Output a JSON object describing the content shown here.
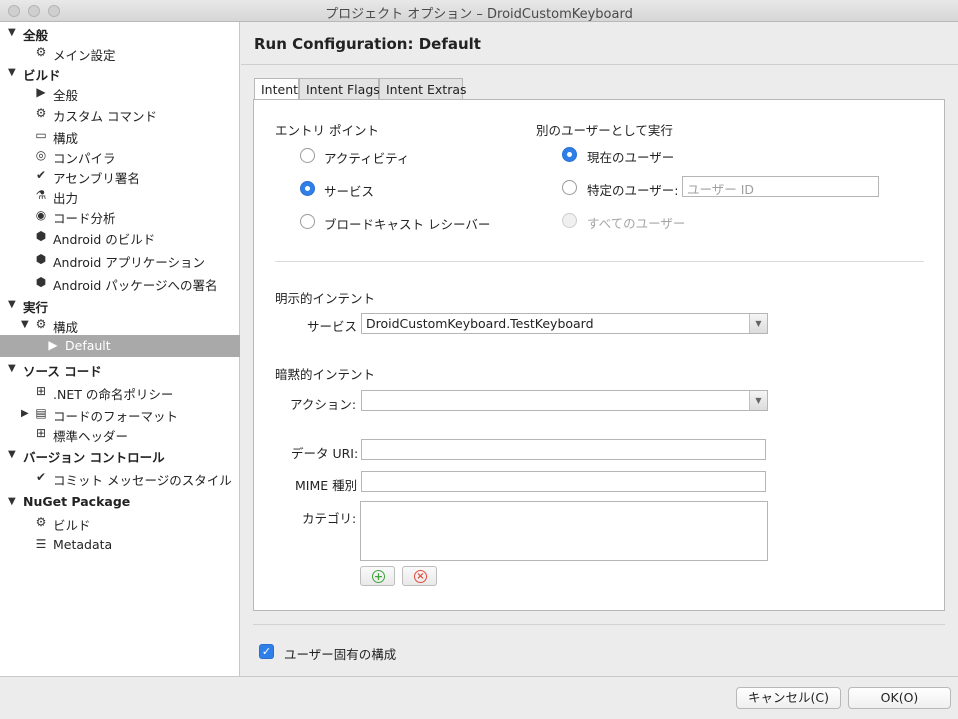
{
  "window": {
    "title": "プロジェクト オプション – DroidCustomKeyboard"
  },
  "sidebar": {
    "items": [
      {
        "label": "全般",
        "arrow": "▼",
        "icon": ""
      },
      {
        "label": "メイン設定",
        "arrow": "",
        "icon": "⚙"
      },
      {
        "label": "ビルド",
        "arrow": "▼",
        "icon": ""
      },
      {
        "label": "全般",
        "arrow": "",
        "icon": "▶"
      },
      {
        "label": "カスタム コマンド",
        "arrow": "",
        "icon": "⚙"
      },
      {
        "label": "構成",
        "arrow": "",
        "icon": "▭"
      },
      {
        "label": "コンパイラ",
        "arrow": "",
        "icon": "◎"
      },
      {
        "label": "アセンブリ署名",
        "arrow": "",
        "icon": "✔"
      },
      {
        "label": "出力",
        "arrow": "",
        "icon": "⚗"
      },
      {
        "label": "コード分析",
        "arrow": "",
        "icon": "◉"
      },
      {
        "label": "Android のビルド",
        "arrow": "",
        "icon": "⬢"
      },
      {
        "label": "Android アプリケーション",
        "arrow": "",
        "icon": "⬢"
      },
      {
        "label": "Android パッケージへの署名",
        "arrow": "",
        "icon": "⬢"
      },
      {
        "label": "実行",
        "arrow": "▼",
        "icon": ""
      },
      {
        "label": "構成",
        "arrow": "▼",
        "icon": "⚙"
      },
      {
        "label": "Default",
        "arrow": "",
        "icon": "▶"
      },
      {
        "label": "ソース コード",
        "arrow": "▼",
        "icon": ""
      },
      {
        "label": ".NET の命名ポリシー",
        "arrow": "",
        "icon": "⊞"
      },
      {
        "label": "コードのフォーマット",
        "arrow": "▶",
        "icon": "▤"
      },
      {
        "label": "標準ヘッダー",
        "arrow": "",
        "icon": "⊞"
      },
      {
        "label": "バージョン コントロール",
        "arrow": "▼",
        "icon": ""
      },
      {
        "label": "コミット メッセージのスタイル",
        "arrow": "",
        "icon": "✔"
      },
      {
        "label": "NuGet Package",
        "arrow": "▼",
        "icon": ""
      },
      {
        "label": "ビルド",
        "arrow": "",
        "icon": "⚙"
      },
      {
        "label": "Metadata",
        "arrow": "",
        "icon": "☰"
      }
    ]
  },
  "main": {
    "title": "Run Configuration: Default",
    "tabs": [
      {
        "label": "Intent"
      },
      {
        "label": "Intent Flags"
      },
      {
        "label": "Intent Extras"
      }
    ],
    "entry_point": {
      "heading": "エントリ ポイント",
      "options": [
        {
          "label": "アクティビティ",
          "selected": false
        },
        {
          "label": "サービス",
          "selected": true
        },
        {
          "label": "ブロードキャスト レシーバー",
          "selected": false
        }
      ]
    },
    "run_as": {
      "heading": "別のユーザーとして実行",
      "current_user": "現在のユーザー",
      "specific_user": "特定のユーザー:",
      "user_id_placeholder": "ユーザー ID",
      "all_users": "すべてのユーザー"
    },
    "explicit_intent": {
      "heading": "明示的インテント",
      "service_label": "サービス",
      "service_value": "DroidCustomKeyboard.TestKeyboard"
    },
    "implicit_intent": {
      "heading": "暗黙的インテント",
      "action_label": "アクション:",
      "action_value": "",
      "data_uri_label": "データ URI:",
      "data_uri_value": "",
      "mime_label": "MIME 種別",
      "mime_value": "",
      "category_label": "カテゴリ:",
      "category_value": ""
    },
    "user_specific_config": {
      "label": "ユーザー固有の構成",
      "checked": true
    }
  },
  "footer": {
    "cancel_label": "キャンセル(C)",
    "ok_label": "OK(O)"
  },
  "colors": {
    "accent": "#2f7fe8",
    "selection": "#a9a9a9",
    "add_icon": "#3fa33f",
    "remove_icon": "#e04a3a"
  }
}
